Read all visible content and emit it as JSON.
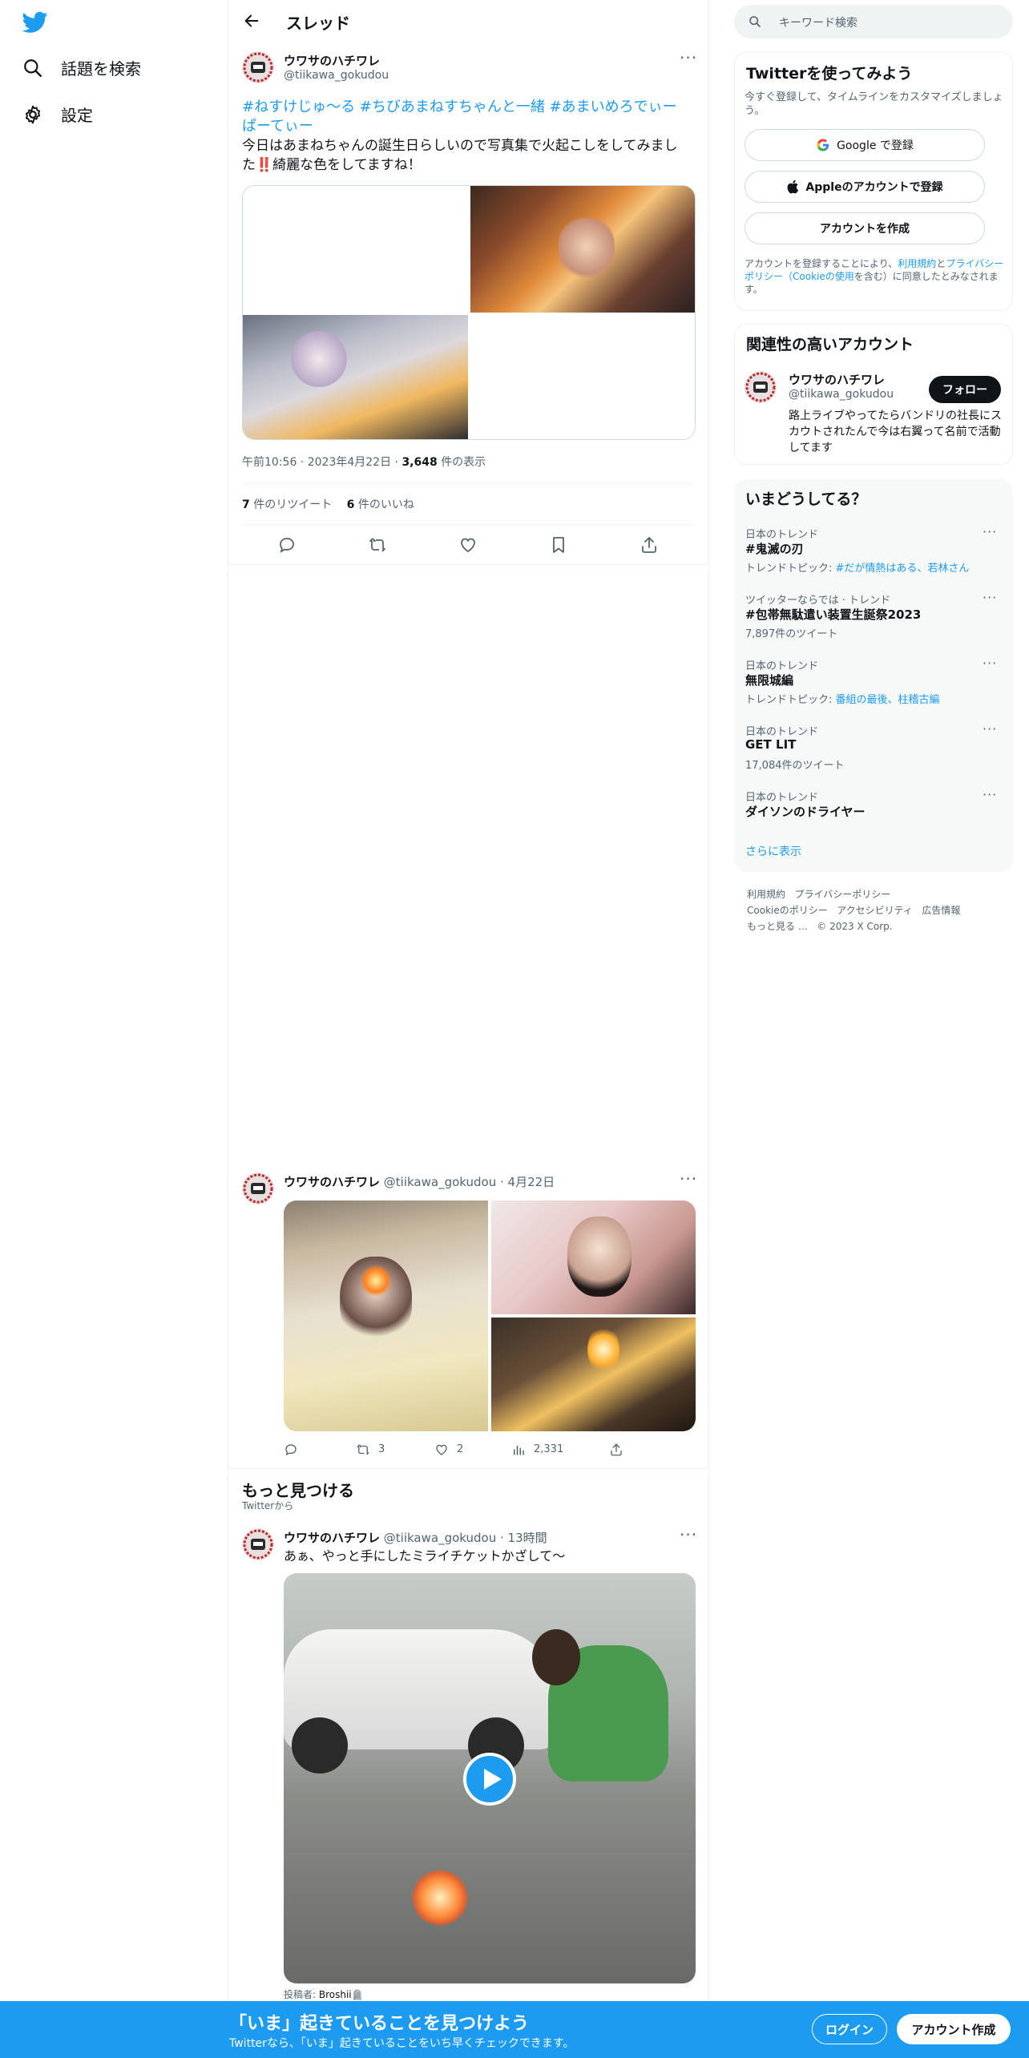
{
  "nav": {
    "explore_label": "話題を検索",
    "settings_label": "設定"
  },
  "header": {
    "title": "スレッド"
  },
  "main_tweet": {
    "author_name": "ウワサのハチワレ",
    "author_handle": "@tiikawa_gokudou",
    "hashtags_line1": "#ねすけじゅ〜る  #ちびあまねすちゃんと一緒  #あまいめろでぃーぱーてぃー",
    "text": "今日はあまねちゃんの誕生日らしいので写真集で火起こしをしてみました‼️綺麗な色をしてますね！",
    "time": "午前10:56",
    "date": "2023年4月22日",
    "views_count": "3,648",
    "views_label": "件の表示",
    "retweets_count": "7",
    "retweets_label": "件のリツイート",
    "likes_count": "6",
    "likes_label": "件のいいね"
  },
  "reply_tweet": {
    "author_name": "ウワサのハチワレ",
    "author_handle": "@tiikawa_gokudou",
    "date": "· 4月22日",
    "retweets": "3",
    "likes": "2",
    "views": "2,331"
  },
  "discover": {
    "title": "もっと見つける",
    "subtitle": "Twitterから"
  },
  "discover_tweet": {
    "author_name": "ウワサのハチワレ",
    "author_handle": "@tiikawa_gokudou",
    "time": "· 13時間",
    "text": "あぁ、やっと手にしたミライチケットかざして〜",
    "posted_by_label": "投稿者:",
    "posted_by_name": "Broshii🪦"
  },
  "search": {
    "placeholder": "キーワード検索"
  },
  "signup": {
    "title": "Twitterを使ってみよう",
    "subtitle": "今すぐ登録して、タイムラインをカスタマイズしましょう。",
    "google_label": "Google で登録",
    "apple_label": "Appleのアカウントで登録",
    "create_label": "アカウントを作成",
    "terms_pre": "アカウントを登録することにより、",
    "terms_link1": "利用規約",
    "terms_and": "と",
    "terms_link2": "プライバシーポリシー（Cookieの使用",
    "terms_post": "を含む）に同意したとみなされます。"
  },
  "related": {
    "title": "関連性の高いアカウント",
    "name": "ウワサのハチワレ",
    "handle": "@tiikawa_gokudou",
    "follow_label": "フォロー",
    "bio": "路上ライブやってたらバンドリの社長にスカウトされたんで今は右翼って名前で活動してます"
  },
  "trends": {
    "title": "いまどうしてる？",
    "items": [
      {
        "meta": "日本のトレンド",
        "name": "#鬼滅の刃",
        "sub_pre": "トレンドトピック: ",
        "sub_link": "#だが情熱はある、若林さん",
        "sub": ""
      },
      {
        "meta": "ツイッターならでは · トレンド",
        "name": "#包帯無駄遣い装置生誕祭2023",
        "sub_pre": "",
        "sub_link": "",
        "sub": "7,897件のツイート"
      },
      {
        "meta": "日本のトレンド",
        "name": "無限城編",
        "sub_pre": "トレンドトピック: ",
        "sub_link": "番組の最後、柱稽古編",
        "sub": ""
      },
      {
        "meta": "日本のトレンド",
        "name": "GET LIT",
        "sub_pre": "",
        "sub_link": "",
        "sub": "17,084件のツイート"
      },
      {
        "meta": "日本のトレンド",
        "name": "ダイソンのドライヤー",
        "sub_pre": "",
        "sub_link": "",
        "sub": ""
      }
    ],
    "show_more": "さらに表示"
  },
  "footer": {
    "line1_a": "利用規約",
    "line1_b": "プライバシーポリシー",
    "line2_a": "Cookieのポリシー",
    "line2_b": "アクセシビリティ",
    "line2_c": "広告情報",
    "line3_a": "もっと見る …",
    "line3_b": "© 2023 X Corp."
  },
  "bottom_bar": {
    "headline": "「いま」起きていることを見つけよう",
    "sub": "Twitterなら、「いま」起きていることをいち早くチェックできます。",
    "login_label": "ログイン",
    "signup_label": "アカウント作成"
  },
  "colors": {
    "accent": "#1d9bf0",
    "text": "#0f1419",
    "muted": "#536471",
    "border": "#eff3f4"
  }
}
